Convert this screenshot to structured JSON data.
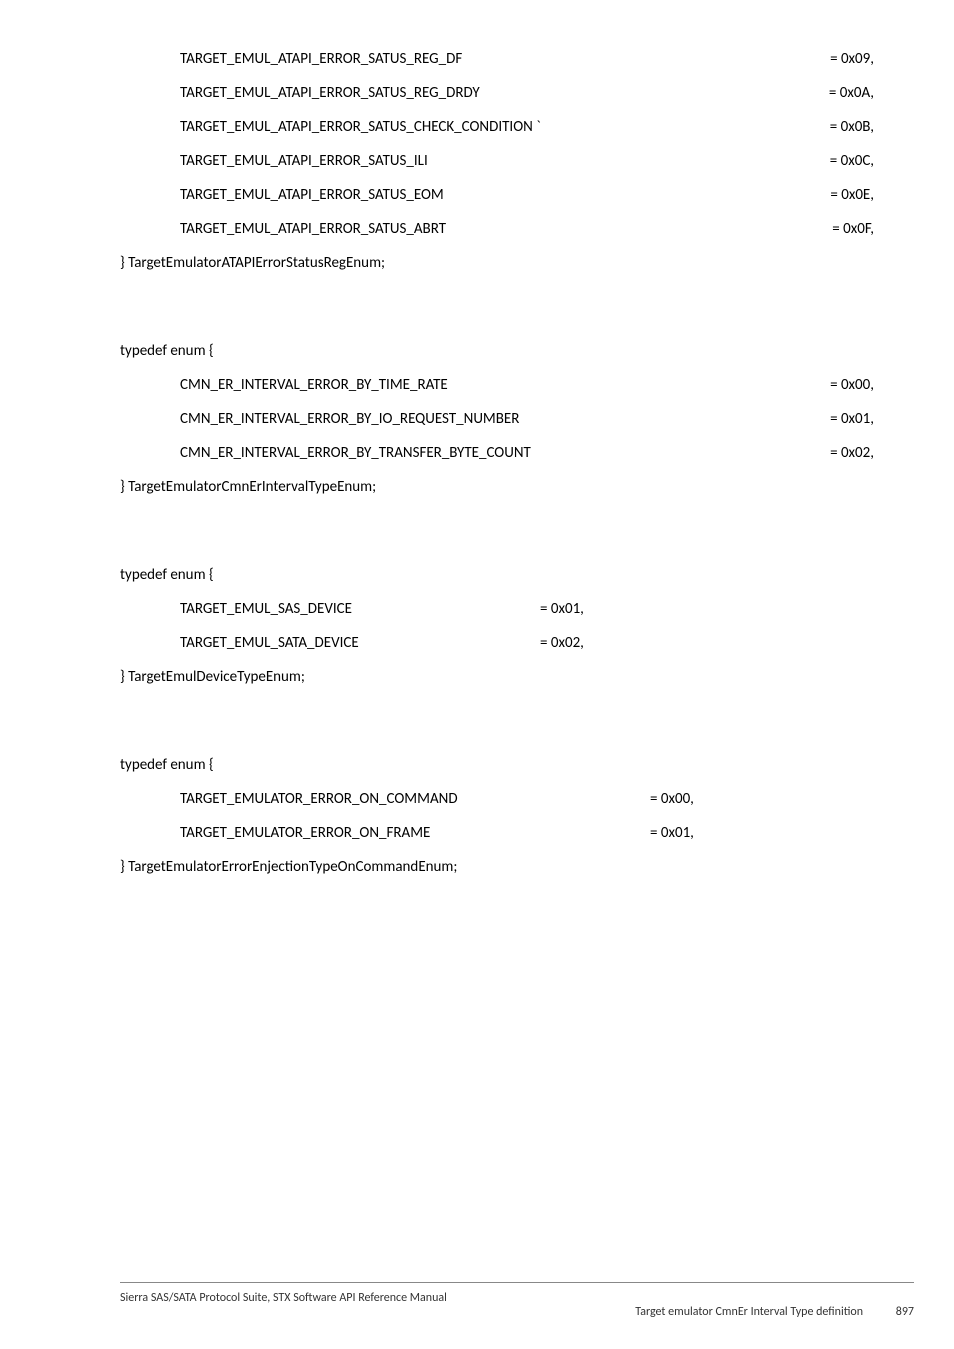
{
  "block1": {
    "items": [
      {
        "name": "TARGET_EMUL_ATAPI_ERROR_SATUS_REG_DF",
        "val": "= 0x09,"
      },
      {
        "name": "TARGET_EMUL_ATAPI_ERROR_SATUS_REG_DRDY",
        "val": "= 0x0A,"
      },
      {
        "name": "TARGET_EMUL_ATAPI_ERROR_SATUS_CHECK_CONDITION `",
        "val": "= 0x0B,"
      },
      {
        "name": "TARGET_EMUL_ATAPI_ERROR_SATUS_ILI",
        "val": "= 0x0C,"
      },
      {
        "name": "TARGET_EMUL_ATAPI_ERROR_SATUS_EOM",
        "val": "= 0x0E,"
      },
      {
        "name": "TARGET_EMUL_ATAPI_ERROR_SATUS_ABRT",
        "val": "= 0x0F,"
      }
    ],
    "closing": "} TargetEmulatorATAPIErrorStatusRegEnum;"
  },
  "block2": {
    "typedef": "typedef enum {",
    "items": [
      {
        "name": "CMN_ER_INTERVAL_ERROR_BY_TIME_RATE",
        "val": "= 0x00,"
      },
      {
        "name": "CMN_ER_INTERVAL_ERROR_BY_IO_REQUEST_NUMBER",
        "val": "= 0x01,"
      },
      {
        "name": "CMN_ER_INTERVAL_ERROR_BY_TRANSFER_BYTE_COUNT",
        "val": "= 0x02,"
      }
    ],
    "closing": "} TargetEmulatorCmnErIntervalTypeEnum;"
  },
  "block3": {
    "typedef": "typedef enum {",
    "items": [
      {
        "name": "TARGET_EMUL_SAS_DEVICE",
        "val": "= 0x01,"
      },
      {
        "name": "TARGET_EMUL_SATA_DEVICE",
        "val": "= 0x02,"
      }
    ],
    "closing": "} TargetEmulDeviceTypeEnum;"
  },
  "block4": {
    "typedef": "typedef enum {",
    "items": [
      {
        "name": "TARGET_EMULATOR_ERROR_ON_COMMAND",
        "val": "= 0x00,"
      },
      {
        "name": "TARGET_EMULATOR_ERROR_ON_FRAME",
        "val": "= 0x01,"
      }
    ],
    "closing": "} TargetEmulatorErrorEnjectionTypeOnCommandEnum;"
  },
  "footer": {
    "line1": "Sierra SAS/SATA Protocol Suite, STX Software API Reference Manual",
    "line2": "Target emulator CmnEr Interval Type definition",
    "page": "897"
  }
}
